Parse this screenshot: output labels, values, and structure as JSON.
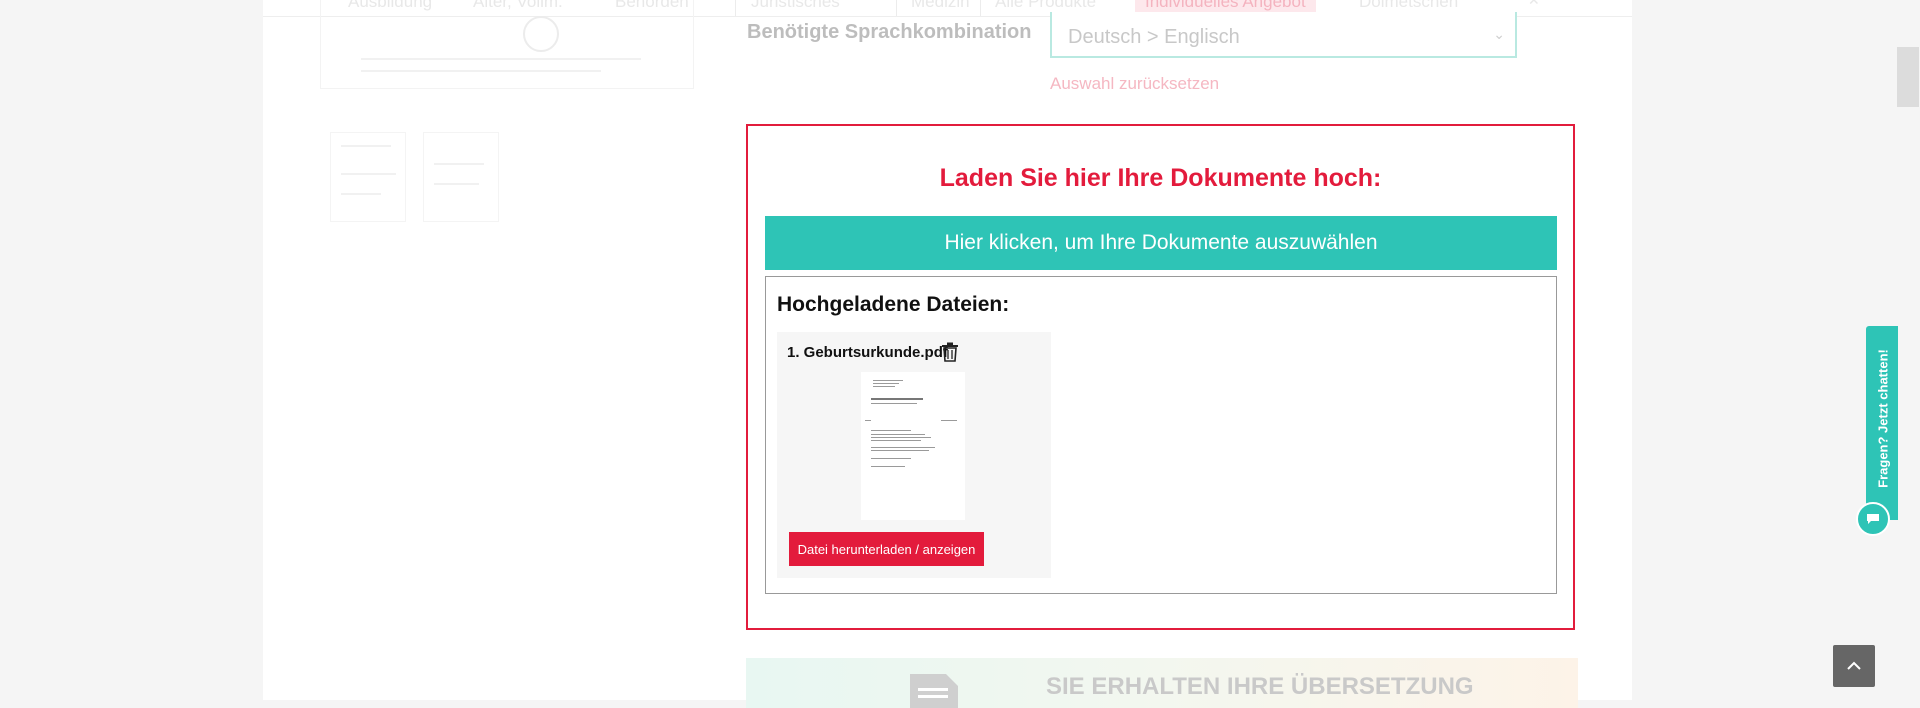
{
  "nav": {
    "items": [
      "Ausbildung",
      "Alter, Vollm.",
      "Behörden",
      "Juristisches",
      "Medizin",
      "Alle Produkte",
      "Individuelles Angebot",
      "Dolmetschen"
    ],
    "active_index": 6
  },
  "form": {
    "language_label": "Benötigte Sprachkombination",
    "language_value": "Deutsch > Englisch",
    "reset_link": "Auswahl zurücksetzen"
  },
  "upload": {
    "title": "Laden Sie hier Ihre Dokumente hoch:",
    "choose_button": "Hier klicken, um Ihre Dokumente auszuwählen",
    "files_heading": "Hochgeladene Dateien:",
    "files": [
      {
        "name": "1. Geburtsurkunde.pdf",
        "download_label": "Datei herunterladen / anzeigen"
      }
    ]
  },
  "banner": {
    "text": "SIE ERHALTEN IHRE ÜBERSETZUNG"
  },
  "chat": {
    "label": "Fragen? Jetzt chatten!"
  },
  "icons": {
    "delete": "trash-icon",
    "chat": "chat-bubble-icon",
    "back_to_top": "chevron-up-icon",
    "select": "chevron-down-icon",
    "banner": "document-icon"
  },
  "colors": {
    "accent_red": "#e31b3c",
    "accent_teal": "#2ec4b6"
  }
}
